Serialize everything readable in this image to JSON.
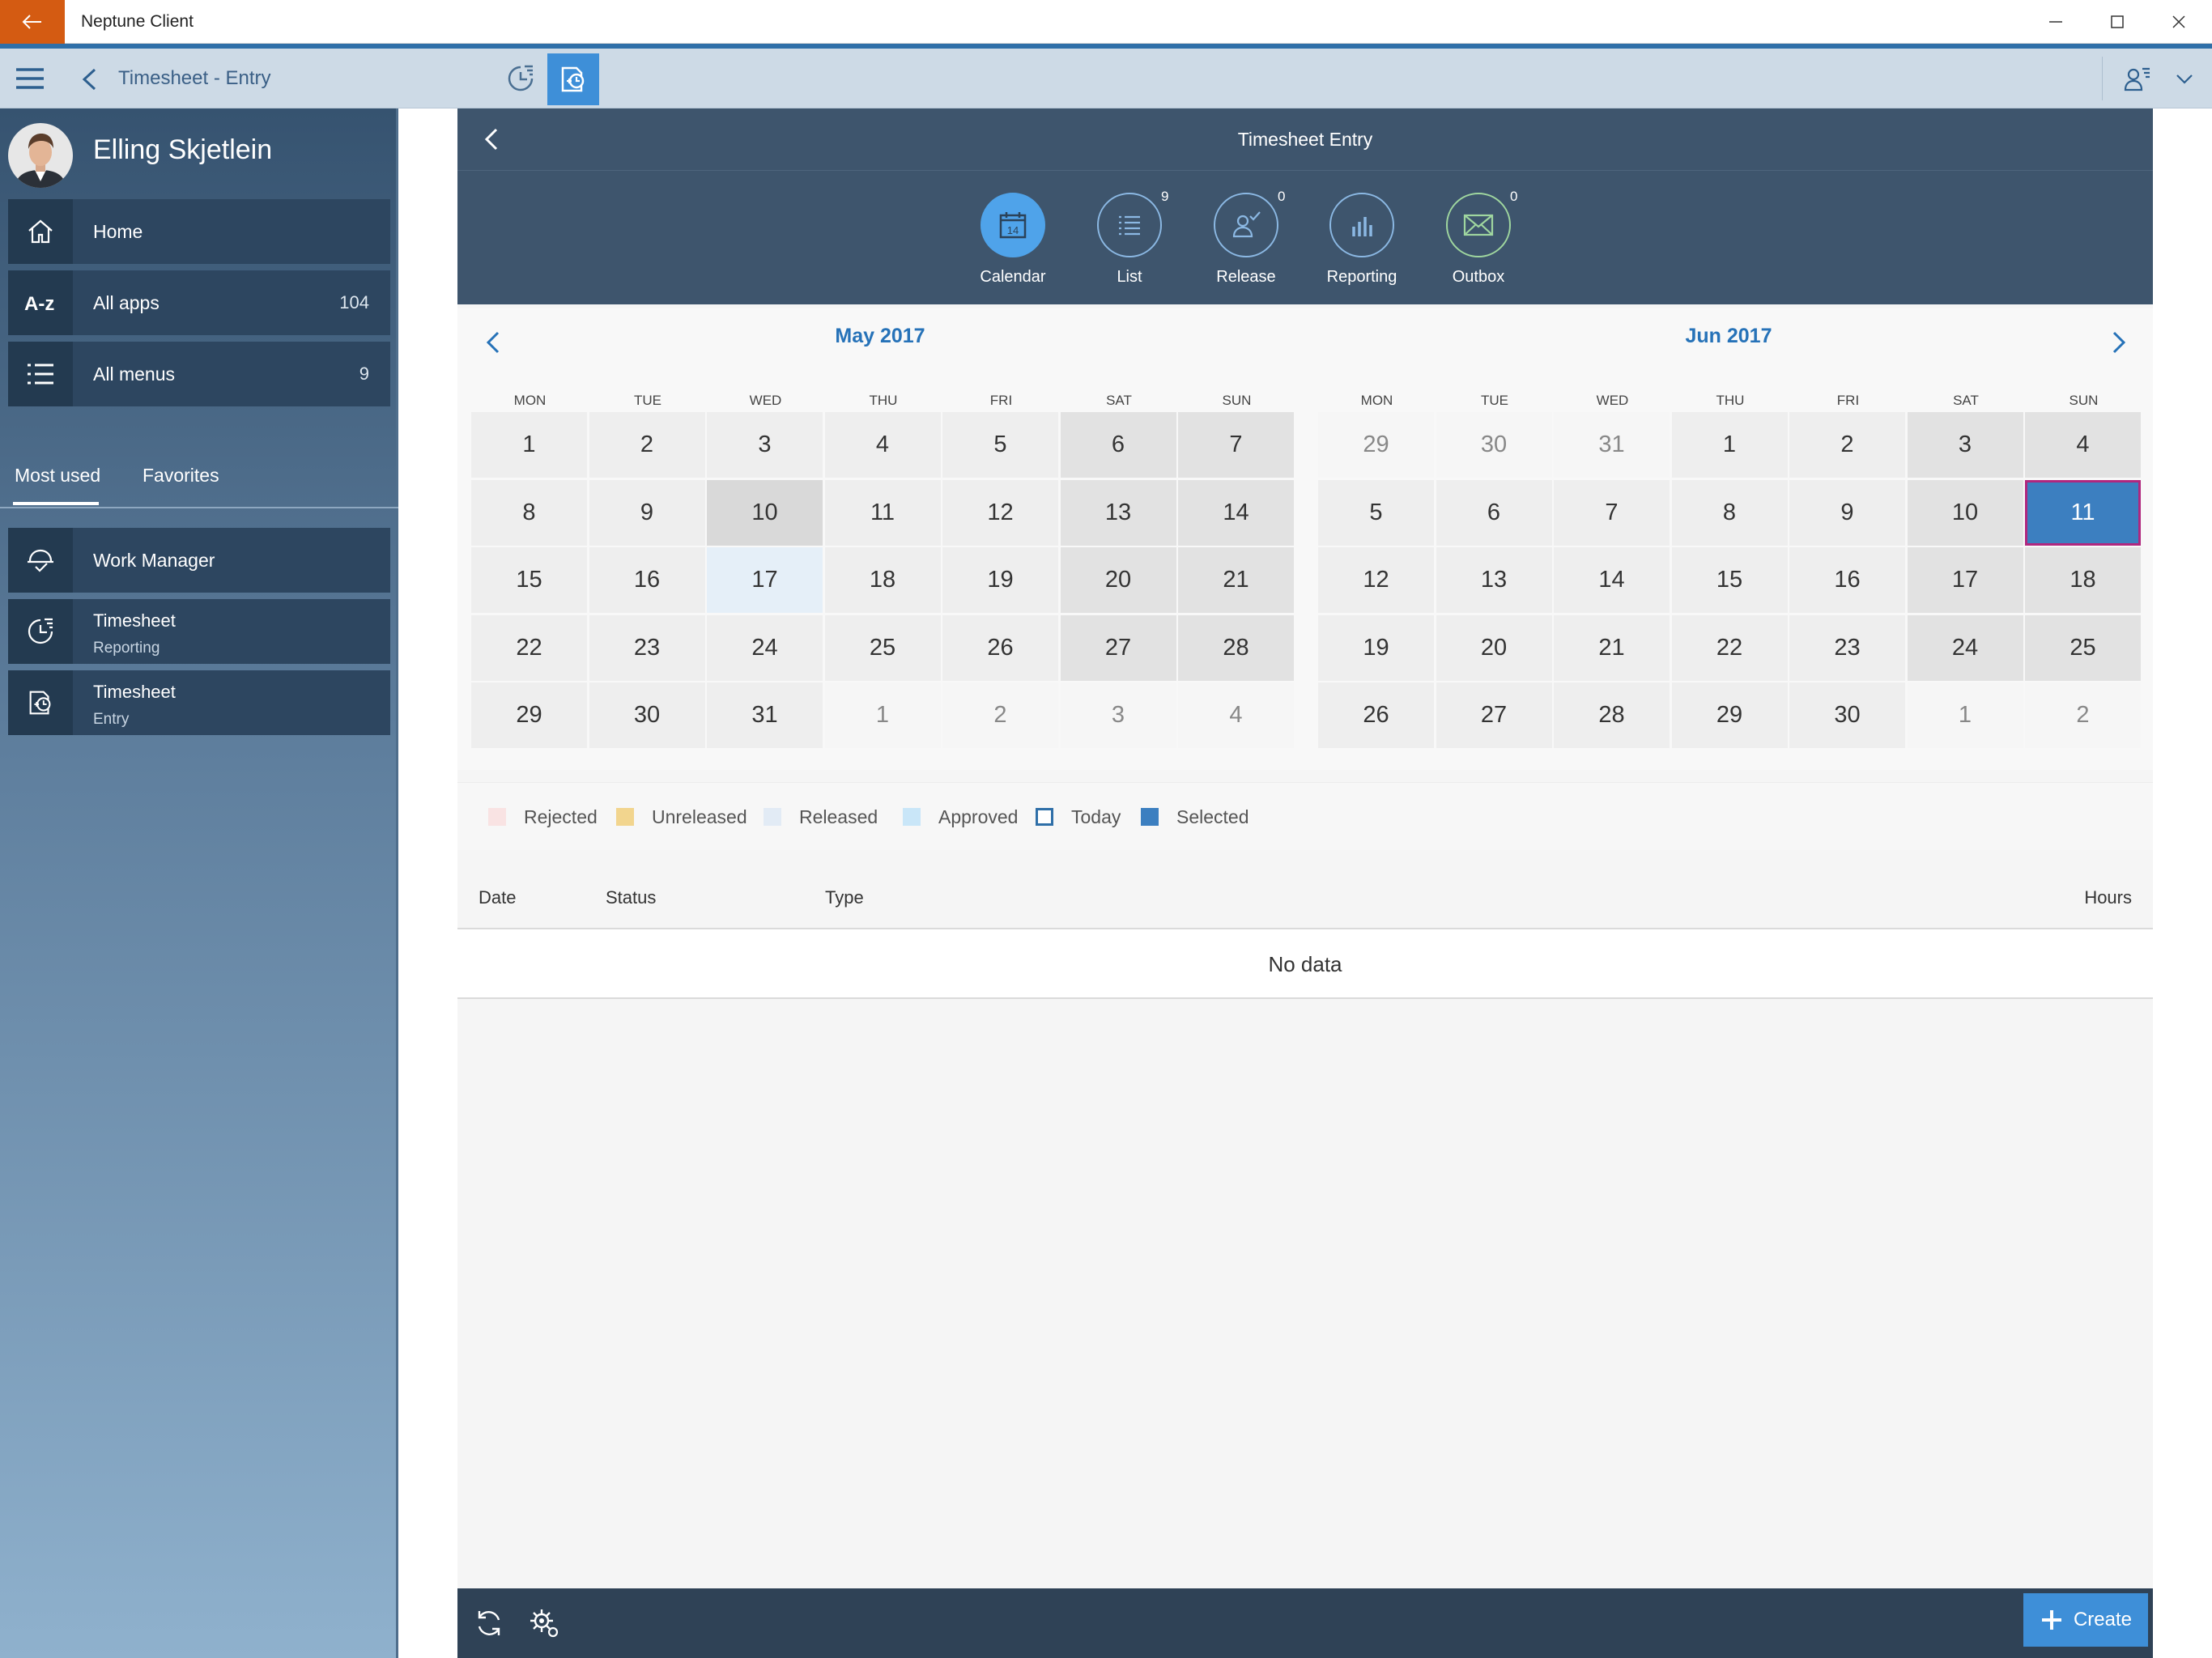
{
  "window": {
    "title": "Neptune Client",
    "accent": "#d45b12"
  },
  "toolbar": {
    "page_title": "Timesheet - Entry"
  },
  "sidebar": {
    "user_name": "Elling Skjetlein",
    "nav": [
      {
        "label": "Home",
        "icon": "home-icon"
      },
      {
        "label": "All apps",
        "count": "104",
        "icon": "a-z-icon"
      },
      {
        "label": "All menus",
        "count": "9",
        "icon": "list-icon"
      }
    ],
    "tabs": {
      "most_used": "Most used",
      "favorites": "Favorites"
    },
    "apps": [
      {
        "label": "Work Manager",
        "icon": "work-manager-icon"
      },
      {
        "label": "Timesheet",
        "sub": "Reporting",
        "icon": "timesheet-reporting-icon"
      },
      {
        "label": "Timesheet",
        "sub": "Entry",
        "icon": "timesheet-entry-icon"
      }
    ]
  },
  "panel": {
    "title": "Timesheet Entry",
    "icon_tabs": [
      {
        "label": "Calendar",
        "icon": "calendar-icon",
        "calendar_day": "14",
        "count": "",
        "active": true
      },
      {
        "label": "List",
        "icon": "list-icon",
        "count": "9"
      },
      {
        "label": "Release",
        "icon": "release-icon",
        "count": "0"
      },
      {
        "label": "Reporting",
        "icon": "bar-chart-icon",
        "count": ""
      },
      {
        "label": "Outbox",
        "icon": "envelope-icon",
        "count": "0"
      }
    ]
  },
  "calendar": {
    "weekdays": [
      "MON",
      "TUE",
      "WED",
      "THU",
      "FRI",
      "SAT",
      "SUN"
    ],
    "months": [
      {
        "title": "May 2017",
        "weeks": [
          [
            "1",
            "2",
            "3",
            "4",
            "5",
            "6",
            "7"
          ],
          [
            "8",
            "9",
            "10",
            "11",
            "12",
            "13",
            "14"
          ],
          [
            "15",
            "16",
            "17",
            "18",
            "19",
            "20",
            "21"
          ],
          [
            "22",
            "23",
            "24",
            "25",
            "26",
            "27",
            "28"
          ],
          [
            "29",
            "30",
            "31",
            "1",
            "2",
            "3",
            "4"
          ]
        ],
        "other_month_cells": [
          [
            4,
            3
          ],
          [
            4,
            4
          ],
          [
            4,
            5
          ],
          [
            4,
            6
          ]
        ],
        "released_cells": [
          [
            2,
            2
          ]
        ],
        "shaded_cells": [
          [
            1,
            2
          ]
        ]
      },
      {
        "title": "Jun 2017",
        "weeks": [
          [
            "29",
            "30",
            "31",
            "1",
            "2",
            "3",
            "4"
          ],
          [
            "5",
            "6",
            "7",
            "8",
            "9",
            "10",
            "11"
          ],
          [
            "12",
            "13",
            "14",
            "15",
            "16",
            "17",
            "18"
          ],
          [
            "19",
            "20",
            "21",
            "22",
            "23",
            "24",
            "25"
          ],
          [
            "26",
            "27",
            "28",
            "29",
            "30",
            "1",
            "2"
          ]
        ],
        "other_month_cells": [
          [
            0,
            0
          ],
          [
            0,
            1
          ],
          [
            0,
            2
          ],
          [
            4,
            5
          ],
          [
            4,
            6
          ]
        ],
        "selected_cell": [
          1,
          6
        ]
      }
    ]
  },
  "legend": [
    {
      "label": "Rejected",
      "color": "#f9e3e3",
      "style": "fill"
    },
    {
      "label": "Unreleased",
      "color": "#f2d58e",
      "style": "fill"
    },
    {
      "label": "Released",
      "color": "#e2ebf5",
      "style": "fill"
    },
    {
      "label": "Approved",
      "color": "#c9e6f8",
      "style": "fill"
    },
    {
      "label": "Today",
      "color": "#2f6fa8",
      "style": "outline"
    },
    {
      "label": "Selected",
      "color": "#3c7fc0",
      "style": "fill"
    }
  ],
  "table": {
    "columns": {
      "date": "Date",
      "status": "Status",
      "type": "Type",
      "hours": "Hours"
    },
    "empty_text": "No data"
  },
  "footer": {
    "create_label": "Create"
  }
}
